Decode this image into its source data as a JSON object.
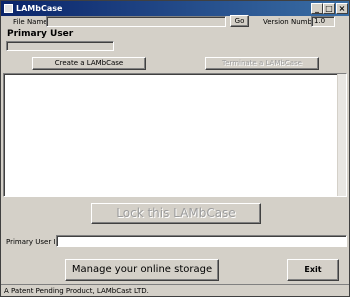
{
  "window": {
    "title": "LAMbCase",
    "controls": {
      "minimize": "_",
      "maximize": "□",
      "close": "×"
    }
  },
  "file": {
    "label": "File Name:",
    "value": "",
    "go_label": "Go"
  },
  "version": {
    "label": "Version Number:",
    "value": "1.0"
  },
  "primary_user": {
    "heading": "Primary User",
    "value": ""
  },
  "buttons": {
    "create": "Create a LAMbCase",
    "terminate": "Terminate a LAMbCase",
    "lock": "Lock this LAMbCase",
    "manage": "Manage your online storage",
    "exit": "Exit"
  },
  "user_info": {
    "label": "Primary User Info:",
    "value": ""
  },
  "status": {
    "text": "A Patent Pending Product, LAMbCast LTD."
  }
}
